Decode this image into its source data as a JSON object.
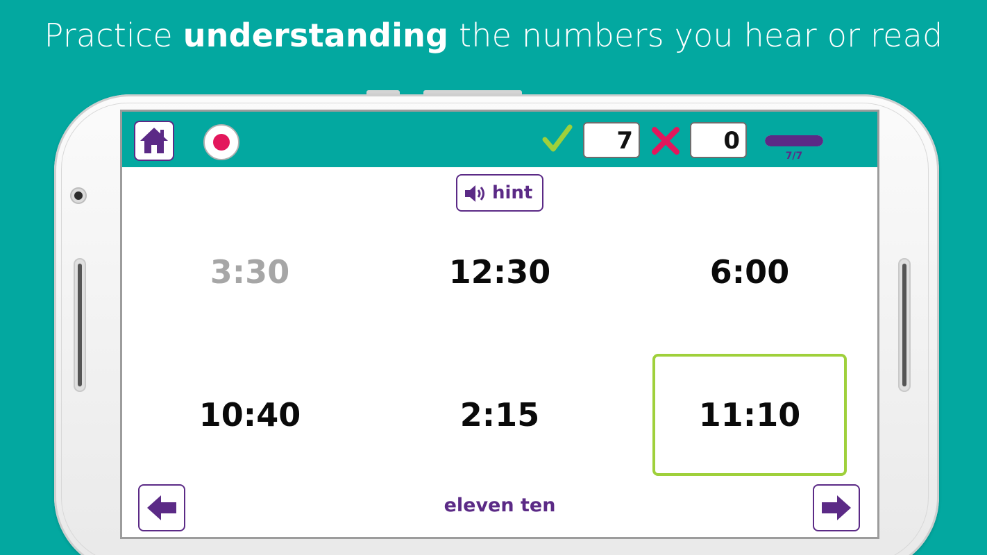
{
  "headline": {
    "prefix": "Practice ",
    "bold": "understanding",
    "suffix": " the numbers you hear or read"
  },
  "toolbar": {
    "home_icon": "home-icon",
    "record_icon": "record-icon",
    "correct_icon": "checkmark-icon",
    "correct_count": "7",
    "wrong_icon": "cross-icon",
    "wrong_count": "0",
    "progress_label": "7/7",
    "progress_fraction": 1.0,
    "accent_color": "#5b2a86",
    "bar_color": "#03a8a0"
  },
  "hint": {
    "icon": "speaker-icon",
    "label": "hint"
  },
  "choices": [
    {
      "label": "3:30",
      "state": "disabled"
    },
    {
      "label": "12:30",
      "state": "normal"
    },
    {
      "label": "6:00",
      "state": "normal"
    },
    {
      "label": "10:40",
      "state": "normal"
    },
    {
      "label": "2:15",
      "state": "normal"
    },
    {
      "label": "11:10",
      "state": "selected"
    }
  ],
  "footer": {
    "prev_icon": "arrow-left-icon",
    "next_icon": "arrow-right-icon",
    "answer_text": "eleven ten"
  },
  "colors": {
    "background": "#03a8a0",
    "selected_border": "#9fd03b",
    "record_red": "#e3175c",
    "check_green": "#9fd03b",
    "cross_pink": "#e3175c"
  }
}
